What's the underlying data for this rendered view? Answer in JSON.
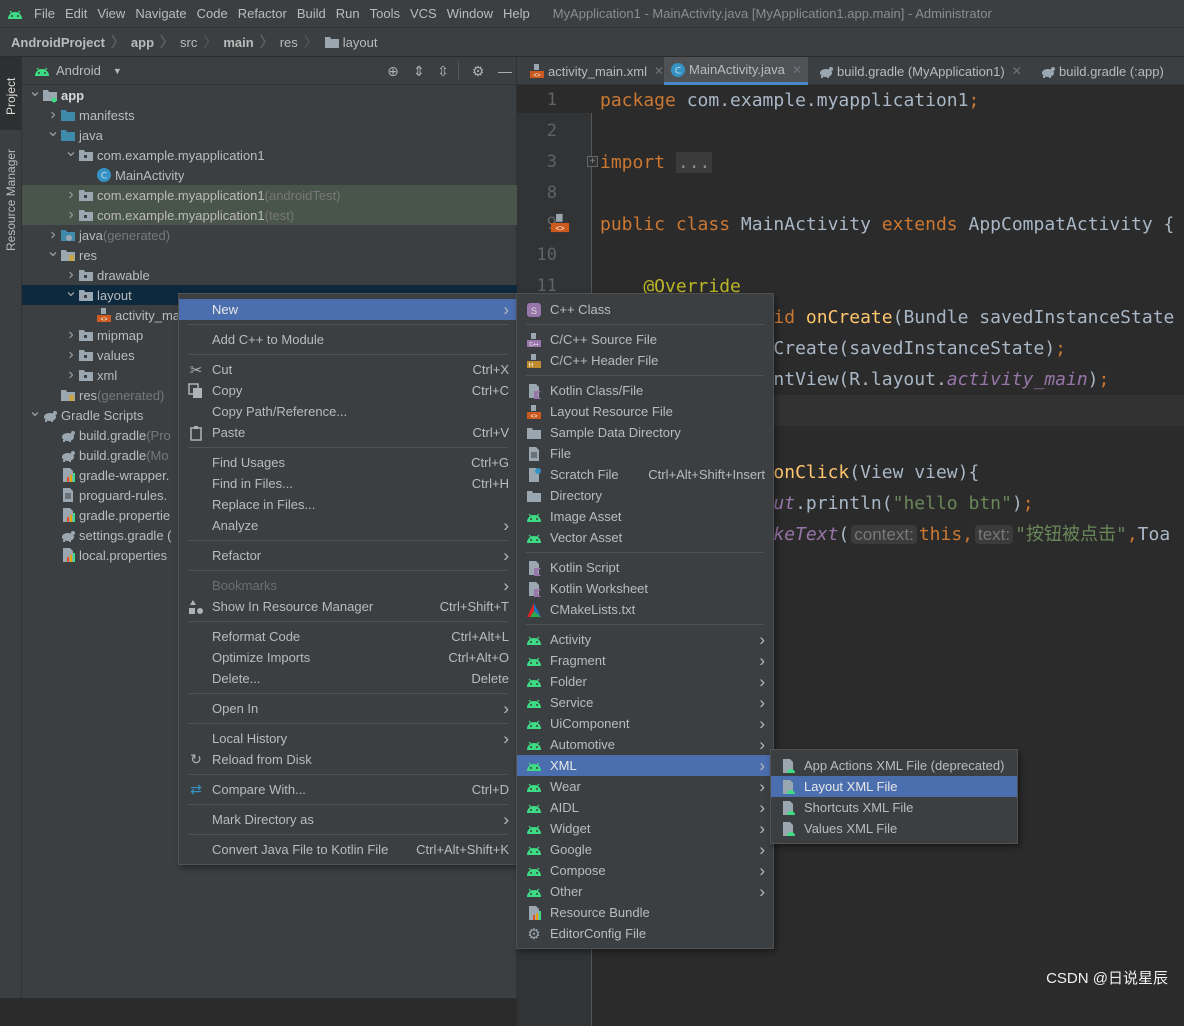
{
  "colors": {
    "accent": "#4b6eaf",
    "android_green": "#3ddc84",
    "selection": "#0d293e",
    "test_highlight": "#49544a"
  },
  "menubar": {
    "items": [
      "File",
      "Edit",
      "View",
      "Navigate",
      "Code",
      "Refactor",
      "Build",
      "Run",
      "Tools",
      "VCS",
      "Window",
      "Help"
    ],
    "title": "MyApplication1 - MainActivity.java [MyApplication1.app.main] - Administrator"
  },
  "breadcrumb": [
    {
      "label": "AndroidProject",
      "bold": true
    },
    {
      "label": "app",
      "bold": true
    },
    {
      "label": "src"
    },
    {
      "label": "main",
      "bold": true
    },
    {
      "label": "res"
    },
    {
      "label": "layout",
      "icon": "folder-icon"
    }
  ],
  "side_strip": {
    "project": "Project",
    "resource_manager": "Resource Manager"
  },
  "project_panel": {
    "view_mode": "Android",
    "tree": [
      {
        "label": "app",
        "level": 0,
        "chevron": "down",
        "icon": "module",
        "bold": true
      },
      {
        "label": "manifests",
        "level": 1,
        "chevron": "right",
        "icon": "folder-blue"
      },
      {
        "label": "java",
        "level": 1,
        "chevron": "down",
        "icon": "folder-blue"
      },
      {
        "label": "com.example.myapplication1",
        "level": 2,
        "chevron": "down",
        "icon": "package"
      },
      {
        "label": "MainActivity",
        "level": 3,
        "icon": "class"
      },
      {
        "label": "com.example.myapplication1",
        "suffix": "(androidTest)",
        "level": 2,
        "chevron": "right",
        "icon": "package",
        "highlight": true
      },
      {
        "label": "com.example.myapplication1",
        "suffix": "(test)",
        "level": 2,
        "chevron": "right",
        "icon": "package",
        "highlight": true
      },
      {
        "label": "java",
        "suffix": "(generated)",
        "level": 1,
        "chevron": "right",
        "icon": "folder-gen"
      },
      {
        "label": "res",
        "level": 1,
        "chevron": "down",
        "icon": "folder-res"
      },
      {
        "label": "drawable",
        "level": 2,
        "chevron": "right",
        "icon": "package"
      },
      {
        "label": "layout",
        "level": 2,
        "chevron": "down",
        "icon": "package",
        "selected": true
      },
      {
        "label": "activity_ma",
        "level": 3,
        "icon": "layout-file"
      },
      {
        "label": "mipmap",
        "level": 2,
        "chevron": "right",
        "icon": "package"
      },
      {
        "label": "values",
        "level": 2,
        "chevron": "right",
        "icon": "package"
      },
      {
        "label": "xml",
        "level": 2,
        "chevron": "right",
        "icon": "package"
      },
      {
        "label": "res",
        "suffix": "(generated)",
        "level": 1,
        "icon": "folder-res"
      },
      {
        "label": "Gradle Scripts",
        "level": 0,
        "chevron": "down",
        "icon": "gradle"
      },
      {
        "label": "build.gradle",
        "suffix": "(Pro",
        "level": 1,
        "icon": "gradle"
      },
      {
        "label": "build.gradle",
        "suffix": "(Mo",
        "level": 1,
        "icon": "gradle"
      },
      {
        "label": "gradle-wrapper.",
        "level": 1,
        "icon": "properties"
      },
      {
        "label": "proguard-rules.",
        "level": 1,
        "icon": "file"
      },
      {
        "label": "gradle.propertie",
        "level": 1,
        "icon": "properties"
      },
      {
        "label": "settings.gradle (",
        "level": 1,
        "icon": "gradle"
      },
      {
        "label": "local.properties",
        "level": 1,
        "icon": "properties"
      }
    ]
  },
  "editor": {
    "tabs": [
      {
        "label": "activity_main.xml",
        "icon": "layout-file"
      },
      {
        "label": "MainActivity.java",
        "icon": "class",
        "active": true
      },
      {
        "label": "build.gradle (MyApplication1)",
        "icon": "gradle"
      },
      {
        "label": "build.gradle (:app)",
        "icon": "gradle"
      }
    ],
    "lines": [
      {
        "n": "1",
        "tokens": [
          [
            "kw",
            "package "
          ],
          [
            "pl",
            "com.example.myapplication1"
          ],
          [
            "kw",
            ";"
          ]
        ]
      },
      {
        "n": "2",
        "tokens": []
      },
      {
        "n": "3",
        "tokens": [
          [
            "kw",
            "import "
          ],
          [
            "fold",
            "..."
          ]
        ]
      },
      {
        "n": "8",
        "tokens": []
      },
      {
        "n": "9",
        "tokens": [
          [
            "kw",
            "public class "
          ],
          [
            "pl",
            "MainActivity "
          ],
          [
            "kw",
            "extends "
          ],
          [
            "pl",
            "AppCompatActivity {"
          ]
        ]
      },
      {
        "n": "10",
        "tokens": []
      },
      {
        "n": "11",
        "tokens": [
          [
            "an",
            "    @Override"
          ]
        ]
      },
      {
        "tokens": [
          [
            "pl",
            "                "
          ],
          [
            "kw",
            "id "
          ],
          [
            "fn",
            "onCreate"
          ],
          [
            "pl",
            "(Bundle savedInstanceState"
          ]
        ]
      },
      {
        "tokens": [
          [
            "pl",
            "                Create(savedInstanceState)"
          ],
          [
            "kw",
            ";"
          ]
        ]
      },
      {
        "tokens": [
          [
            "pl",
            "                ntView(R.layout."
          ],
          [
            "sf",
            "activity_main"
          ],
          [
            "pl",
            ")"
          ],
          [
            "kw",
            ";"
          ]
        ]
      },
      {
        "tokens": [],
        "current": true
      },
      {
        "tokens": []
      },
      {
        "tokens": [
          [
            "pl",
            "                "
          ],
          [
            "fn",
            "onClick"
          ],
          [
            "pl",
            "(View view){"
          ]
        ]
      },
      {
        "tokens": [
          [
            "pl",
            "                "
          ],
          [
            "sf",
            "ut"
          ],
          [
            "pl",
            ".println("
          ],
          [
            "st",
            "\"hello btn\""
          ],
          [
            "pl",
            ")"
          ],
          [
            "kw",
            ";"
          ]
        ]
      },
      {
        "tokens": [
          [
            "pl",
            "                "
          ],
          [
            "sf",
            "keText"
          ],
          [
            "pl",
            "("
          ],
          [
            "hint",
            "context:"
          ],
          [
            "kw",
            "this,"
          ],
          [
            "hint",
            "text:"
          ],
          [
            "st",
            "\"按钮被点击\""
          ],
          [
            "kw",
            ","
          ],
          [
            "pl",
            "Toa"
          ]
        ]
      }
    ]
  },
  "context_menu": [
    {
      "label": "New",
      "arrow": true,
      "active": true
    },
    {
      "sep": true
    },
    {
      "label": "Add C++ to Module"
    },
    {
      "sep": true
    },
    {
      "label": "Cut",
      "icon": "scissors",
      "shortcut": "Ctrl+X"
    },
    {
      "label": "Copy",
      "icon": "copy",
      "shortcut": "Ctrl+C"
    },
    {
      "label": "Copy Path/Reference..."
    },
    {
      "label": "Paste",
      "icon": "paste",
      "shortcut": "Ctrl+V"
    },
    {
      "sep": true
    },
    {
      "label": "Find Usages",
      "shortcut": "Ctrl+G"
    },
    {
      "label": "Find in Files...",
      "shortcut": "Ctrl+H"
    },
    {
      "label": "Replace in Files..."
    },
    {
      "label": "Analyze",
      "arrow": true
    },
    {
      "sep": true
    },
    {
      "label": "Refactor",
      "arrow": true
    },
    {
      "sep": true
    },
    {
      "label": "Bookmarks",
      "arrow": true,
      "disabled": true
    },
    {
      "label": "Show In Resource Manager",
      "icon": "resource-manager",
      "shortcut": "Ctrl+Shift+T"
    },
    {
      "sep": true
    },
    {
      "label": "Reformat Code",
      "shortcut": "Ctrl+Alt+L"
    },
    {
      "label": "Optimize Imports",
      "shortcut": "Ctrl+Alt+O"
    },
    {
      "label": "Delete...",
      "shortcut": "Delete"
    },
    {
      "sep": true
    },
    {
      "label": "Open In",
      "arrow": true
    },
    {
      "sep": true
    },
    {
      "label": "Local History",
      "arrow": true
    },
    {
      "label": "Reload from Disk",
      "icon": "reload"
    },
    {
      "sep": true
    },
    {
      "label": "Compare With...",
      "icon": "compare",
      "shortcut": "Ctrl+D"
    },
    {
      "sep": true
    },
    {
      "label": "Mark Directory as",
      "arrow": true
    },
    {
      "sep": true
    },
    {
      "label": "Convert Java File to Kotlin File",
      "shortcut": "Ctrl+Alt+Shift+K"
    }
  ],
  "new_submenu": [
    {
      "label": "C++ Class",
      "icon": "cpp-class"
    },
    {
      "sep": true
    },
    {
      "label": "C/C++ Source File",
      "icon": "cpp-source"
    },
    {
      "label": "C/C++ Header File",
      "icon": "cpp-header"
    },
    {
      "sep": true
    },
    {
      "label": "Kotlin Class/File",
      "icon": "kotlin"
    },
    {
      "label": "Layout Resource File",
      "icon": "layout-file"
    },
    {
      "label": "Sample Data Directory",
      "icon": "folder"
    },
    {
      "label": "File",
      "icon": "file"
    },
    {
      "label": "Scratch File",
      "icon": "scratch",
      "shortcut": "Ctrl+Alt+Shift+Insert"
    },
    {
      "label": "Directory",
      "icon": "folder"
    },
    {
      "label": "Image Asset",
      "icon": "android"
    },
    {
      "label": "Vector Asset",
      "icon": "android"
    },
    {
      "sep": true
    },
    {
      "label": "Kotlin Script",
      "icon": "kotlin"
    },
    {
      "label": "Kotlin Worksheet",
      "icon": "kotlin"
    },
    {
      "label": "CMakeLists.txt",
      "icon": "cmake"
    },
    {
      "sep": true
    },
    {
      "label": "Activity",
      "icon": "android",
      "arrow": true
    },
    {
      "label": "Fragment",
      "icon": "android",
      "arrow": true
    },
    {
      "label": "Folder",
      "icon": "android",
      "arrow": true
    },
    {
      "label": "Service",
      "icon": "android",
      "arrow": true
    },
    {
      "label": "UiComponent",
      "icon": "android",
      "arrow": true
    },
    {
      "label": "Automotive",
      "icon": "android",
      "arrow": true
    },
    {
      "label": "XML",
      "icon": "android",
      "arrow": true,
      "active": true
    },
    {
      "label": "Wear",
      "icon": "android",
      "arrow": true
    },
    {
      "label": "AIDL",
      "icon": "android",
      "arrow": true
    },
    {
      "label": "Widget",
      "icon": "android",
      "arrow": true
    },
    {
      "label": "Google",
      "icon": "android",
      "arrow": true
    },
    {
      "label": "Compose",
      "icon": "android",
      "arrow": true
    },
    {
      "label": "Other",
      "icon": "android",
      "arrow": true
    },
    {
      "label": "Resource Bundle",
      "icon": "properties"
    },
    {
      "label": "EditorConfig File",
      "icon": "gear"
    }
  ],
  "xml_submenu": [
    {
      "label": "App Actions XML File (deprecated)",
      "icon": "xml-android"
    },
    {
      "label": "Layout XML File",
      "icon": "xml-android",
      "active": true
    },
    {
      "label": "Shortcuts XML File",
      "icon": "xml-android"
    },
    {
      "label": "Values XML File",
      "icon": "xml-android"
    }
  ],
  "watermark": "CSDN @日说星辰"
}
